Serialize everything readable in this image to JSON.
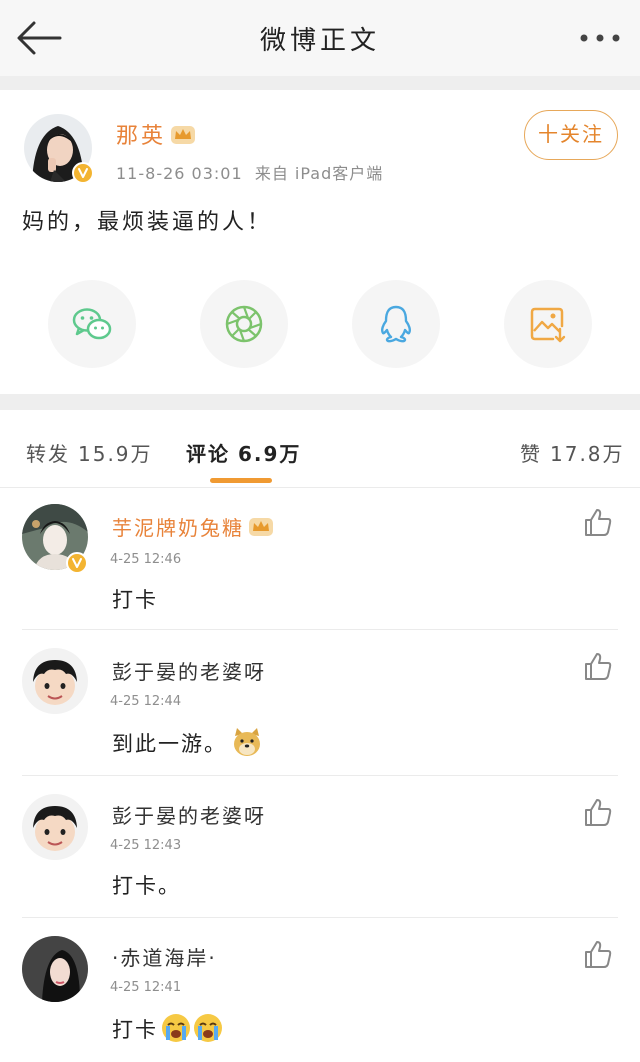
{
  "nav": {
    "title": "微博正文"
  },
  "post": {
    "author": "那英",
    "time": "11-8-26 03:01",
    "source": "来自 iPad客户端",
    "follow_label": "十关注",
    "text": "妈的，最烦装逼的人！",
    "share_icons": [
      "wechat-icon",
      "moments-icon",
      "qq-icon",
      "save-image-icon"
    ]
  },
  "tabs": {
    "repost_label": "转发",
    "repost_count": "15.9万",
    "comment_label": "评论",
    "comment_count": "6.9万",
    "like_label": "赞",
    "like_count": "17.8万"
  },
  "comments": [
    {
      "name": "芋泥牌奶兔糖",
      "time": "4-25 12:46",
      "text": "打卡",
      "verified": true,
      "vip": true
    },
    {
      "name": "彭于晏的老婆呀",
      "time": "4-25 12:44",
      "text": "到此一游。",
      "emoji": "doge-emoji"
    },
    {
      "name": "彭于晏的老婆呀",
      "time": "4-25 12:43",
      "text": "打卡。"
    },
    {
      "name": "·赤道海岸·",
      "time": "4-25 12:41",
      "text": "打卡",
      "emoji": "crying-emoji"
    }
  ],
  "colors": {
    "accent": "#e8833a",
    "tab_underline": "#f09a32",
    "vip_gold": "#f3b431",
    "wechat": "#5ec98d",
    "moments": "#7cc36c",
    "qq": "#4aa8e0",
    "save": "#f0a844"
  }
}
